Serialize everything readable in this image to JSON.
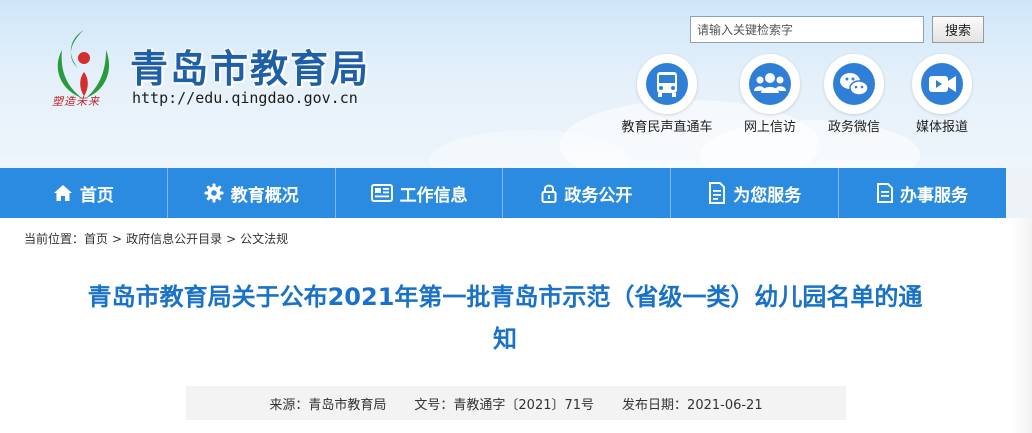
{
  "site": {
    "title": "青岛市教育局",
    "url": "http://edu.qingdao.gov.cn",
    "slogan": "塑造未来"
  },
  "search": {
    "placeholder": "请输入关键检索字",
    "button_label": "搜索"
  },
  "quick_links": [
    {
      "label": "教育民声直通车",
      "icon": "bus-icon"
    },
    {
      "label": "网上信访",
      "icon": "people-icon"
    },
    {
      "label": "政务微信",
      "icon": "wechat-icon"
    },
    {
      "label": "媒体报道",
      "icon": "video-icon"
    }
  ],
  "nav": [
    {
      "label": "首页",
      "icon": "home-icon"
    },
    {
      "label": "教育概况",
      "icon": "gear-icon"
    },
    {
      "label": "工作信息",
      "icon": "newspaper-icon"
    },
    {
      "label": "政务公开",
      "icon": "lock-icon"
    },
    {
      "label": "为您服务",
      "icon": "document-icon"
    },
    {
      "label": "办事服务",
      "icon": "file-icon"
    }
  ],
  "breadcrumb": {
    "prefix": "当前位置：",
    "items": [
      "首页",
      "政府信息公开目录",
      "公文法规"
    ],
    "separator": ">"
  },
  "article": {
    "title_line1": "青岛市教育局关于公布2021年第一批青岛市示范（省级一类）幼儿园名单的通",
    "title_line2": "知",
    "source": "来源：青岛市教育局",
    "doc_number": "文号：青教通字〔2021〕71号",
    "publish_date": "发布日期：2021-06-21"
  },
  "colors": {
    "nav_bg": "#2b8be0",
    "title_blue": "#1a72c8",
    "brand_blue": "#1f5fa6",
    "icon_blue": "#2f7fd6",
    "logo_green": "#2a9a3c",
    "logo_red": "#d62d2d"
  }
}
